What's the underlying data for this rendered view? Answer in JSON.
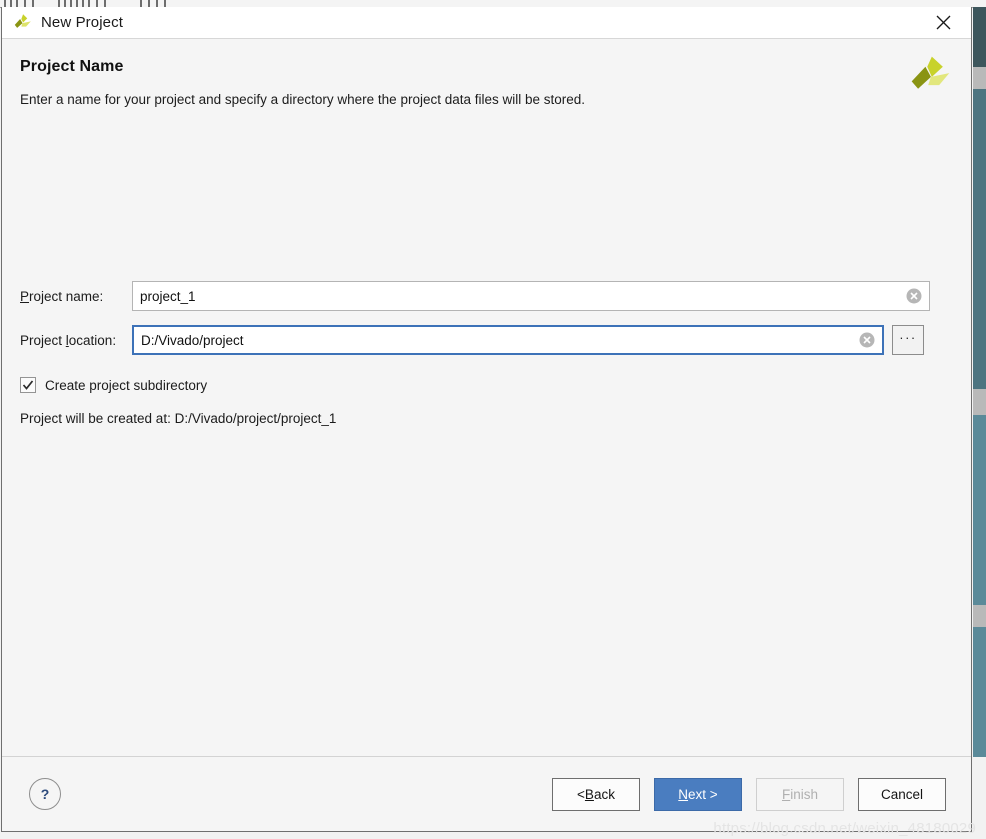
{
  "window": {
    "title": "New Project",
    "icon": "xilinx-logo-icon",
    "close_label": "✕"
  },
  "header": {
    "title": "Project Name",
    "description": "Enter a name for your project and specify a directory where the project data files will be stored.",
    "logo": "xilinx-logo-icon"
  },
  "form": {
    "project_name": {
      "label_prefix": "",
      "label_mnemonic": "P",
      "label_suffix": "roject name:",
      "value": "project_1",
      "placeholder": "",
      "clear_icon": "clear-circle-icon"
    },
    "project_location": {
      "label_prefix": "Project ",
      "label_mnemonic": "l",
      "label_suffix": "ocation:",
      "value": "D:/Vivado/project",
      "placeholder": "",
      "clear_icon": "clear-circle-icon",
      "browse_label": "···"
    },
    "create_subdirectory": {
      "label": "Create project subdirectory",
      "checked": true,
      "check_glyph": "✓"
    },
    "created_at_text": "Project will be created at: D:/Vivado/project/project_1"
  },
  "footer": {
    "help_label": "?",
    "buttons": [
      {
        "prefix": "< ",
        "mnemonic": "B",
        "suffix": "ack",
        "state": "normal"
      },
      {
        "prefix": "",
        "mnemonic": "N",
        "suffix": "ext >",
        "state": "primary"
      },
      {
        "prefix": "",
        "mnemonic": "F",
        "suffix": "inish",
        "state": "disabled"
      },
      {
        "prefix": "",
        "mnemonic": "",
        "suffix": "Cancel",
        "state": "normal"
      }
    ]
  },
  "watermark": "https://blog.csdn.net/weixin_48180029",
  "colors": {
    "primary_blue": "#4a7dc0",
    "focus_blue": "#3d72b8",
    "dialog_bg": "#f5f5f5",
    "brand_yellow": "#cbd52a",
    "brand_olive": "#7f8c1a",
    "background_teal": "#5b8a99"
  }
}
